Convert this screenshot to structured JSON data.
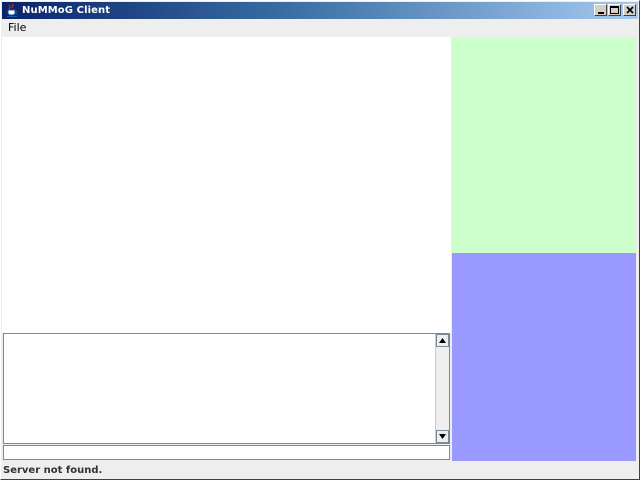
{
  "window": {
    "title": "NuMMoG Client",
    "icon": "java-coffee-cup-icon"
  },
  "title_buttons": {
    "minimize_icon": "minimize-icon",
    "maximize_icon": "maximize-icon",
    "close_icon": "close-icon"
  },
  "menubar": {
    "items": [
      {
        "label": "File"
      }
    ]
  },
  "panels": {
    "side_top_color": "#ccffcc",
    "side_bottom_color": "#9999ff",
    "canvas_color": "#ffffff"
  },
  "chat": {
    "log_text": "",
    "input_value": "",
    "input_placeholder": ""
  },
  "status": {
    "text": "Server not found."
  }
}
